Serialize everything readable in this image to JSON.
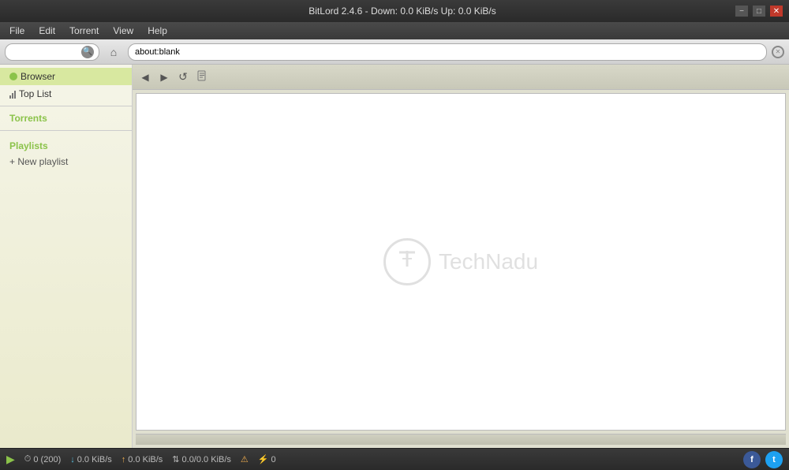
{
  "titlebar": {
    "title": "BitLord  2.4.6 - Down: 0.0 KiB/s  Up: 0.0 KiB/s",
    "minimize": "−",
    "maximize": "□",
    "close": "✕"
  },
  "menubar": {
    "items": [
      "File",
      "Edit",
      "Torrent",
      "View",
      "Help"
    ]
  },
  "toolbar": {
    "search_placeholder": "",
    "url": "about:blank"
  },
  "sidebar": {
    "browser_label": "Browser",
    "top_list_label": "Top List",
    "torrents_label": "Torrents",
    "playlists_label": "Playlists",
    "new_playlist_label": "+ New playlist"
  },
  "browser": {
    "back_label": "◀",
    "forward_label": "▶",
    "reload_label": "↺",
    "doc_label": "📄",
    "watermark_letter": "T",
    "watermark_text": "TechNadu"
  },
  "statusbar": {
    "play_icon": "▶",
    "queue_icon": "⏱",
    "queue_count": "0 (200)",
    "down_icon": "↓",
    "down_speed": "0.0 KiB/s",
    "up_icon": "↑",
    "up_speed": "0.0 KiB/s",
    "transfer_icon": "⇅",
    "transfer": "0.0/0.0 KiB/s",
    "warning_icon": "⚠",
    "share_icon": "⚡",
    "share_count": "0",
    "facebook_label": "f",
    "twitter_label": "t"
  }
}
